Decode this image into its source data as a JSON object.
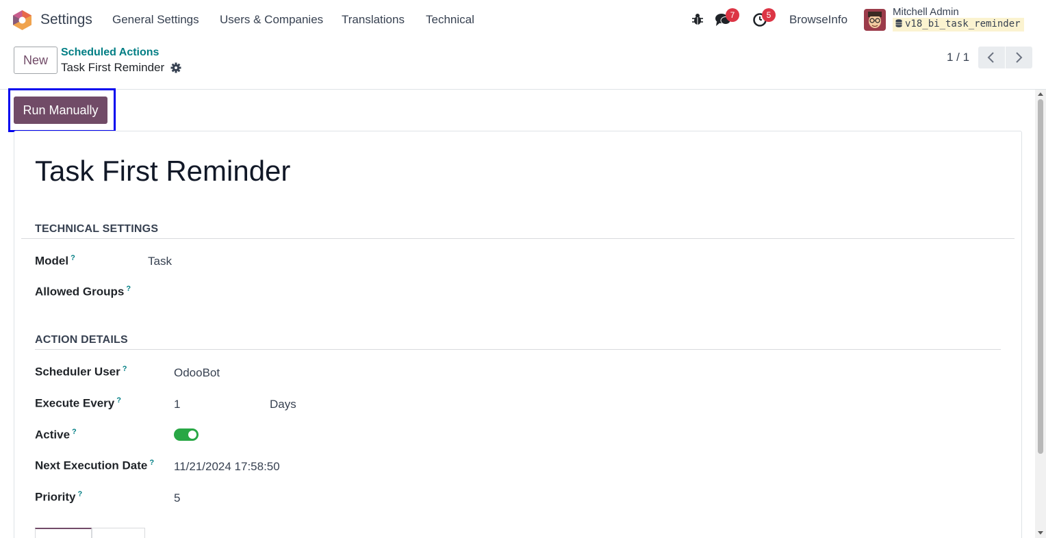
{
  "navbar": {
    "app_title": "Settings",
    "menu": [
      "General Settings",
      "Users & Companies",
      "Translations",
      "Technical"
    ],
    "messages_count": "7",
    "activities_count": "5",
    "company": "BrowseInfo",
    "user_name": "Mitchell Admin",
    "database": "v18_bi_task_reminder"
  },
  "control_panel": {
    "new_label": "New",
    "breadcrumb_parent": "Scheduled Actions",
    "breadcrumb_current": "Task First Reminder",
    "pager": "1 / 1"
  },
  "actions": {
    "run_manually": "Run Manually"
  },
  "form": {
    "title": "Task First Reminder",
    "technical_section": "TECHNICAL SETTINGS",
    "model_label": "Model",
    "model_value": "Task",
    "groups_label": "Allowed Groups",
    "action_section": "ACTION DETAILS",
    "scheduler_user_label": "Scheduler User",
    "scheduler_user_value": "OdooBot",
    "execute_every_label": "Execute Every",
    "execute_every_value": "1",
    "execute_every_unit": "Days",
    "active_label": "Active",
    "active_value": true,
    "next_execution_label": "Next Execution Date",
    "next_execution_value": "11/21/2024 17:58:50",
    "priority_label": "Priority",
    "priority_value": "5",
    "help_marker": "?"
  },
  "colors": {
    "brand": "#714b67",
    "link": "#017e84",
    "badge": "#dc3545",
    "toggle_on": "#28a745",
    "highlight": "#0000ee"
  }
}
